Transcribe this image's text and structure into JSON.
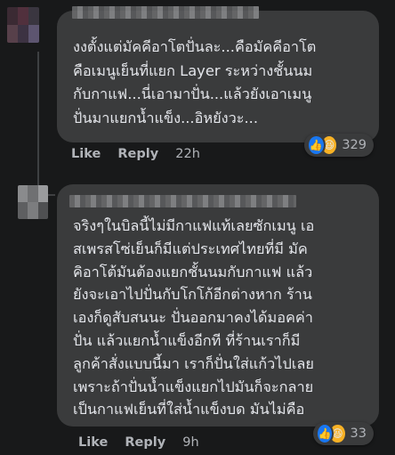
{
  "comments": [
    {
      "text": "งงตั้งแต่มัคคีอาโตปั่นละ...คือมัคคีอาโต\nคือเมนูเย็นที่แยก Layer ระหว่างชั้นนม\nกับกาแฟ...นี่เอามาปั่น...แล้วยังเอาเมนู\nปั่นมาแยกน้ำแข็ง...อิหยังวะ...",
      "actions": {
        "like": "Like",
        "reply": "Reply",
        "time": "22h"
      },
      "reaction_count": "329",
      "reaction_icons": [
        "like-icon",
        "haha-icon"
      ]
    },
    {
      "text": "จริงๆในบิลนี้ไม่มีกาแฟแท้เลยซักเมนู เอ\nสเพรสโซ่เย็นก็มีแต่ประเทศไทยที่มี มัค\nคิอาโต้มันต้องแยกชั้นนมกับกาแฟ แล้ว\nยังจะเอาไปปั่นกับโกโก้อีกต่างหาก ร้าน\nเองก็ดูสับสนนะ ปั่นออกมาคงได้มอคค่า\nปั่น แล้วแยกน้ำแข็งอีกที ที่ร้านเราก็มี\nลูกค้าสั่งแบบนี้มา เราก็ปั่นใส่แก้วไปเลย\nเพราะถ้าปั่นน้ำแข็งแยกไปมันก็จะกลาย\nเป็นกาแฟเย็นที่ใส่น้ำแข็งบด มันไม่คือ",
      "actions": {
        "like": "Like",
        "reply": "Reply",
        "time": "9h"
      },
      "reaction_count": "33",
      "reaction_icons": [
        "like-icon",
        "haha-icon"
      ]
    }
  ],
  "colors": {
    "background": "#18191a",
    "bubble": "#3a3b3c",
    "text": "#e4e6eb",
    "muted": "#b0b3b8",
    "like": "#1877f2",
    "haha": "#f7b125"
  }
}
